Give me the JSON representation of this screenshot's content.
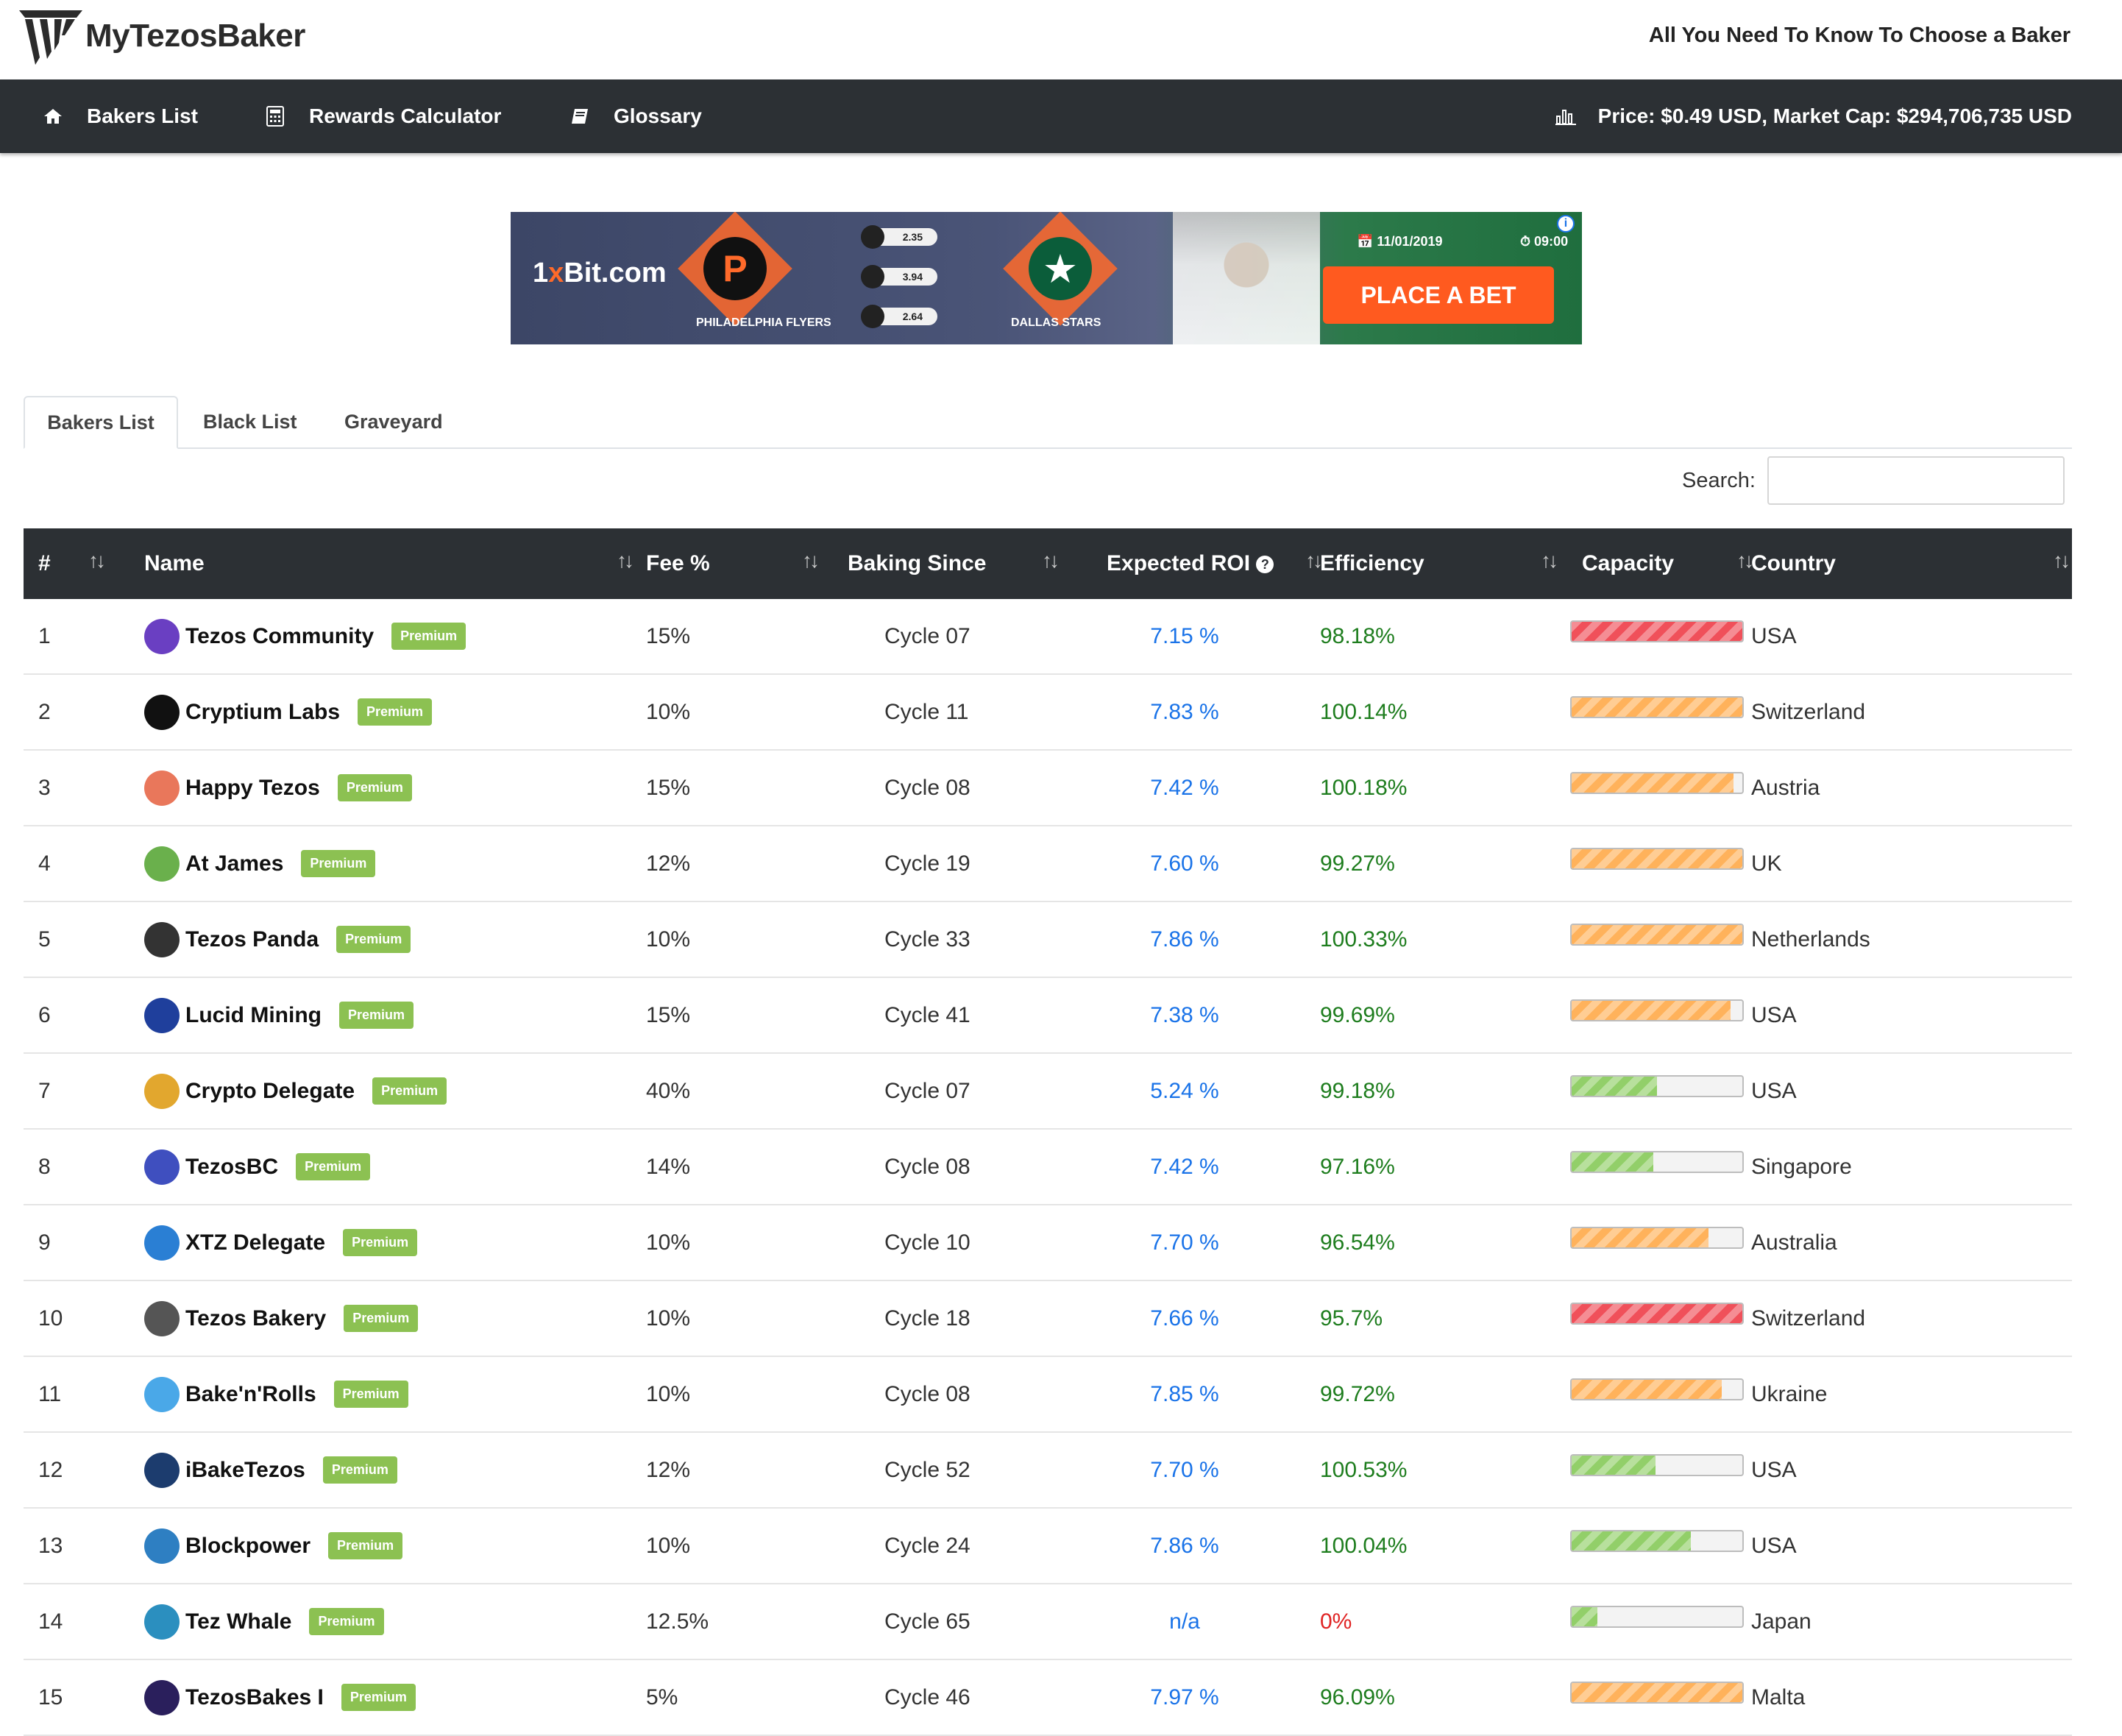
{
  "header": {
    "logo_text": "MyTezosBaker",
    "tagline": "All You Need To Know To Choose a Baker"
  },
  "nav": {
    "items": [
      {
        "label": "Bakers List",
        "icon": "home-icon"
      },
      {
        "label": "Rewards Calculator",
        "icon": "calculator-icon"
      },
      {
        "label": "Glossary",
        "icon": "book-icon"
      }
    ],
    "price_text": "Price: $0.49 USD, Market Cap: $294,706,735 USD",
    "price_icon": "bar-chart-icon"
  },
  "ad": {
    "brand_prefix": "1",
    "brand_x": "x",
    "brand_suffix": "Bit.com",
    "team1": "PHILADELPHIA FLYERS",
    "team2": "DALLAS STARS",
    "odds": [
      "2.35",
      "3.94",
      "2.64"
    ],
    "date": "11/01/2019",
    "time": "09:00",
    "cta": "PLACE A BET"
  },
  "tabs": [
    "Bakers List",
    "Black List",
    "Graveyard"
  ],
  "search": {
    "label": "Search:",
    "value": ""
  },
  "table": {
    "headers": [
      "#",
      "Name",
      "Fee %",
      "Baking Since",
      "Expected ROI",
      "Efficiency",
      "Capacity",
      "Country"
    ],
    "badge_label": "Premium",
    "rows": [
      {
        "rank": "1",
        "name": "Tezos Community",
        "fee": "15%",
        "since": "Cycle 07",
        "roi": "7.15 %",
        "eff": "98.18%",
        "capacity": 1.0,
        "cap_color": "red",
        "country": "USA",
        "avatar_color": "#6a3fc2"
      },
      {
        "rank": "2",
        "name": "Cryptium Labs",
        "fee": "10%",
        "since": "Cycle 11",
        "roi": "7.83 %",
        "eff": "100.14%",
        "capacity": 1.0,
        "cap_color": "orange",
        "country": "Switzerland",
        "avatar_color": "#111111"
      },
      {
        "rank": "3",
        "name": "Happy Tezos",
        "fee": "15%",
        "since": "Cycle 08",
        "roi": "7.42 %",
        "eff": "100.18%",
        "capacity": 0.95,
        "cap_color": "orange",
        "country": "Austria",
        "avatar_color": "#e9775b"
      },
      {
        "rank": "4",
        "name": "At James",
        "fee": "12%",
        "since": "Cycle 19",
        "roi": "7.60 %",
        "eff": "99.27%",
        "capacity": 1.0,
        "cap_color": "orange",
        "country": "UK",
        "avatar_color": "#6ab04c"
      },
      {
        "rank": "5",
        "name": "Tezos Panda",
        "fee": "10%",
        "since": "Cycle 33",
        "roi": "7.86 %",
        "eff": "100.33%",
        "capacity": 1.0,
        "cap_color": "orange",
        "country": "Netherlands",
        "avatar_color": "#333333"
      },
      {
        "rank": "6",
        "name": "Lucid Mining",
        "fee": "15%",
        "since": "Cycle 41",
        "roi": "7.38 %",
        "eff": "99.69%",
        "capacity": 0.93,
        "cap_color": "orange",
        "country": "USA",
        "avatar_color": "#1f3f9c"
      },
      {
        "rank": "7",
        "name": "Crypto Delegate",
        "fee": "40%",
        "since": "Cycle 07",
        "roi": "5.24 %",
        "eff": "99.18%",
        "capacity": 0.5,
        "cap_color": "green",
        "country": "USA",
        "avatar_color": "#e2a72e"
      },
      {
        "rank": "8",
        "name": "TezosBC",
        "fee": "14%",
        "since": "Cycle 08",
        "roi": "7.42 %",
        "eff": "97.16%",
        "capacity": 0.48,
        "cap_color": "green",
        "country": "Singapore",
        "avatar_color": "#3f4fbf"
      },
      {
        "rank": "9",
        "name": "XTZ Delegate",
        "fee": "10%",
        "since": "Cycle 10",
        "roi": "7.70 %",
        "eff": "96.54%",
        "capacity": 0.8,
        "cap_color": "orange",
        "country": "Australia",
        "avatar_color": "#2a7fd4"
      },
      {
        "rank": "10",
        "name": "Tezos Bakery",
        "fee": "10%",
        "since": "Cycle 18",
        "roi": "7.66 %",
        "eff": "95.7%",
        "capacity": 1.0,
        "cap_color": "red",
        "country": "Switzerland",
        "avatar_color": "#555555"
      },
      {
        "rank": "11",
        "name": "Bake'n'Rolls",
        "fee": "10%",
        "since": "Cycle 08",
        "roi": "7.85 %",
        "eff": "99.72%",
        "capacity": 0.88,
        "cap_color": "orange",
        "country": "Ukraine",
        "avatar_color": "#4aa8e8"
      },
      {
        "rank": "12",
        "name": "iBakeTezos",
        "fee": "12%",
        "since": "Cycle 52",
        "roi": "7.70 %",
        "eff": "100.53%",
        "capacity": 0.49,
        "cap_color": "green",
        "country": "USA",
        "avatar_color": "#1c3c6e"
      },
      {
        "rank": "13",
        "name": "Blockpower",
        "fee": "10%",
        "since": "Cycle 24",
        "roi": "7.86 %",
        "eff": "100.04%",
        "capacity": 0.7,
        "cap_color": "green",
        "country": "USA",
        "avatar_color": "#2e7fc2"
      },
      {
        "rank": "14",
        "name": "Tez Whale",
        "fee": "12.5%",
        "since": "Cycle 65",
        "roi": "n/a",
        "eff": "0%",
        "capacity": 0.15,
        "cap_color": "green",
        "country": "Japan",
        "avatar_color": "#2b8fbf"
      },
      {
        "rank": "15",
        "name": "TezosBakes I",
        "fee": "5%",
        "since": "Cycle 46",
        "roi": "7.97 %",
        "eff": "96.09%",
        "capacity": 1.0,
        "cap_color": "orange",
        "country": "Malta",
        "avatar_color": "#2a1f5c"
      }
    ]
  }
}
